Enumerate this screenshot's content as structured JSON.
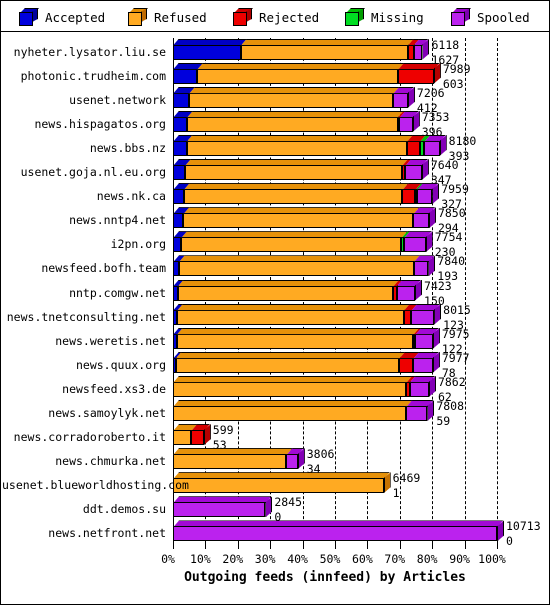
{
  "legend": {
    "items": [
      {
        "label": "Accepted",
        "color": "#0000dd",
        "icon": "cube-icon"
      },
      {
        "label": "Refused",
        "color": "#ffaa22",
        "icon": "cube-icon"
      },
      {
        "label": "Rejected",
        "color": "#ee0000",
        "icon": "cube-icon"
      },
      {
        "label": "Missing",
        "color": "#00dd22",
        "icon": "cube-icon"
      },
      {
        "label": "Spooled",
        "color": "#bb22ee",
        "icon": "cube-icon"
      }
    ]
  },
  "chart_data": {
    "type": "bar",
    "orientation": "horizontal",
    "stacked": true,
    "title": "",
    "xlabel": "Outgoing feeds (innfeed) by Articles",
    "ylabel": "",
    "xlim": [
      0,
      110
    ],
    "xticks": [
      "0%",
      "10%",
      "20%",
      "30%",
      "40%",
      "50%",
      "60%",
      "70%",
      "80%",
      "90%",
      "100%"
    ],
    "xtick_values": [
      0,
      10,
      20,
      30,
      40,
      50,
      60,
      70,
      80,
      90,
      100
    ],
    "grid": true,
    "legend_position": "top",
    "series_names": [
      "Accepted",
      "Refused",
      "Rejected",
      "Missing",
      "Spooled"
    ],
    "series_colors": [
      "#0000dd",
      "#ffaa22",
      "#ee0000",
      "#00dd22",
      "#bb22ee"
    ],
    "categories": [
      "nyheter.lysator.liu.se",
      "photonic.trudheim.com",
      "usenet.network",
      "news.hispagatos.org",
      "news.bbs.nz",
      "usenet.goja.nl.eu.org",
      "news.nk.ca",
      "news.nntp4.net",
      "i2pn.org",
      "newsfeed.bofh.team",
      "nntp.comgw.net",
      "news.tnetconsulting.net",
      "news.weretis.net",
      "news.quux.org",
      "newsfeed.xs3.de",
      "news.samoylyk.net",
      "news.corradoroberto.it",
      "news.chmurka.net",
      "usenet.blueworldhosting.com",
      "ddt.demos.su",
      "news.netfront.net"
    ],
    "rows": [
      {
        "label": "nyheter.lysator.liu.se",
        "value_top": "6118",
        "value_bottom": "1627",
        "total_pct": 77.0,
        "segments": [
          {
            "name": "Accepted",
            "pct": 21.0
          },
          {
            "name": "Refused",
            "pct": 51.5
          },
          {
            "name": "Rejected",
            "pct": 1.8
          },
          {
            "name": "Spooled",
            "pct": 2.7
          }
        ]
      },
      {
        "label": "photonic.trudheim.com",
        "value_top": "7989",
        "value_bottom": "603",
        "total_pct": 80.5,
        "segments": [
          {
            "name": "Accepted",
            "pct": 7.5
          },
          {
            "name": "Refused",
            "pct": 62.0
          },
          {
            "name": "Rejected",
            "pct": 11.0
          }
        ]
      },
      {
        "label": "usenet.network",
        "value_top": "7206",
        "value_bottom": "412",
        "total_pct": 72.5,
        "segments": [
          {
            "name": "Accepted",
            "pct": 5.0
          },
          {
            "name": "Refused",
            "pct": 63.0
          },
          {
            "name": "Spooled",
            "pct": 4.5
          }
        ]
      },
      {
        "label": "news.hispagatos.org",
        "value_top": "7353",
        "value_bottom": "396",
        "total_pct": 74.0,
        "segments": [
          {
            "name": "Accepted",
            "pct": 4.3
          },
          {
            "name": "Refused",
            "pct": 65.0
          },
          {
            "name": "Rejected",
            "pct": 0.6
          },
          {
            "name": "Spooled",
            "pct": 4.1
          }
        ]
      },
      {
        "label": "news.bbs.nz",
        "value_top": "8180",
        "value_bottom": "393",
        "total_pct": 82.3,
        "segments": [
          {
            "name": "Accepted",
            "pct": 4.2
          },
          {
            "name": "Refused",
            "pct": 68.0
          },
          {
            "name": "Rejected",
            "pct": 4.0
          },
          {
            "name": "Missing",
            "pct": 1.4
          },
          {
            "name": "Spooled",
            "pct": 4.7
          }
        ]
      },
      {
        "label": "usenet.goja.nl.eu.org",
        "value_top": "7640",
        "value_bottom": "347",
        "total_pct": 76.8,
        "segments": [
          {
            "name": "Accepted",
            "pct": 3.7
          },
          {
            "name": "Refused",
            "pct": 67.0
          },
          {
            "name": "Rejected",
            "pct": 1.0
          },
          {
            "name": "Spooled",
            "pct": 5.1
          }
        ]
      },
      {
        "label": "news.nk.ca",
        "value_top": "7959",
        "value_bottom": "327",
        "total_pct": 80.0,
        "segments": [
          {
            "name": "Accepted",
            "pct": 3.3
          },
          {
            "name": "Refused",
            "pct": 67.5
          },
          {
            "name": "Rejected",
            "pct": 4.0
          },
          {
            "name": "Missing",
            "pct": 0.5
          },
          {
            "name": "Spooled",
            "pct": 4.7
          }
        ]
      },
      {
        "label": "news.nntp4.net",
        "value_top": "7850",
        "value_bottom": "294",
        "total_pct": 79.0,
        "segments": [
          {
            "name": "Accepted",
            "pct": 3.2
          },
          {
            "name": "Refused",
            "pct": 71.0
          },
          {
            "name": "Spooled",
            "pct": 4.8
          }
        ]
      },
      {
        "label": "i2pn.org",
        "value_top": "7754",
        "value_bottom": "230",
        "total_pct": 78.0,
        "segments": [
          {
            "name": "Accepted",
            "pct": 2.5
          },
          {
            "name": "Refused",
            "pct": 68.0
          },
          {
            "name": "Missing",
            "pct": 0.8
          },
          {
            "name": "Spooled",
            "pct": 6.7
          }
        ]
      },
      {
        "label": "newsfeed.bofh.team",
        "value_top": "7840",
        "value_bottom": "193",
        "total_pct": 78.8,
        "segments": [
          {
            "name": "Accepted",
            "pct": 1.8
          },
          {
            "name": "Refused",
            "pct": 72.5
          },
          {
            "name": "Spooled",
            "pct": 4.5
          }
        ]
      },
      {
        "label": "nntp.comgw.net",
        "value_top": "7423",
        "value_bottom": "150",
        "total_pct": 74.7,
        "segments": [
          {
            "name": "Accepted",
            "pct": 1.5
          },
          {
            "name": "Refused",
            "pct": 66.5
          },
          {
            "name": "Rejected",
            "pct": 1.0
          },
          {
            "name": "Spooled",
            "pct": 5.7
          }
        ]
      },
      {
        "label": "news.tnetconsulting.net",
        "value_top": "8015",
        "value_bottom": "123",
        "total_pct": 80.6,
        "segments": [
          {
            "name": "Accepted",
            "pct": 1.3
          },
          {
            "name": "Refused",
            "pct": 70.0
          },
          {
            "name": "Rejected",
            "pct": 2.3
          },
          {
            "name": "Spooled",
            "pct": 7.0
          }
        ]
      },
      {
        "label": "news.weretis.net",
        "value_top": "7975",
        "value_bottom": "122",
        "total_pct": 80.2,
        "segments": [
          {
            "name": "Accepted",
            "pct": 1.2
          },
          {
            "name": "Refused",
            "pct": 73.0
          },
          {
            "name": "Rejected",
            "pct": 0.6
          },
          {
            "name": "Spooled",
            "pct": 5.4
          }
        ]
      },
      {
        "label": "news.quux.org",
        "value_top": "7977",
        "value_bottom": "78",
        "total_pct": 80.2,
        "segments": [
          {
            "name": "Accepted",
            "pct": 0.8
          },
          {
            "name": "Refused",
            "pct": 69.0
          },
          {
            "name": "Rejected",
            "pct": 4.4
          },
          {
            "name": "Spooled",
            "pct": 6.0
          }
        ]
      },
      {
        "label": "newsfeed.xs3.de",
        "value_top": "7862",
        "value_bottom": "62",
        "total_pct": 79.0,
        "segments": [
          {
            "name": "Refused",
            "pct": 72.0
          },
          {
            "name": "Rejected",
            "pct": 1.0
          },
          {
            "name": "Spooled",
            "pct": 6.0
          }
        ]
      },
      {
        "label": "news.samoylyk.net",
        "value_top": "7808",
        "value_bottom": "59",
        "total_pct": 78.5,
        "segments": [
          {
            "name": "Refused",
            "pct": 72.0
          },
          {
            "name": "Spooled",
            "pct": 6.5
          }
        ]
      },
      {
        "label": "news.corradoroberto.it",
        "value_top": "599",
        "value_bottom": "53",
        "total_pct": 9.5,
        "segments": [
          {
            "name": "Refused",
            "pct": 5.6
          },
          {
            "name": "Rejected",
            "pct": 3.9
          }
        ]
      },
      {
        "label": "news.chmurka.net",
        "value_top": "3806",
        "value_bottom": "34",
        "total_pct": 38.5,
        "segments": [
          {
            "name": "Refused",
            "pct": 35.0
          },
          {
            "name": "Spooled",
            "pct": 3.5
          }
        ]
      },
      {
        "label": "usenet.blueworldhosting.com",
        "value_top": "6469",
        "value_bottom": "1",
        "total_pct": 65.0,
        "segments": [
          {
            "name": "Refused",
            "pct": 65.0
          }
        ]
      },
      {
        "label": "ddt.demos.su",
        "value_top": "2845",
        "value_bottom": "0",
        "total_pct": 28.5,
        "segments": [
          {
            "name": "Spooled",
            "pct": 28.5
          }
        ]
      },
      {
        "label": "news.netfront.net",
        "value_top": "10713",
        "value_bottom": "0",
        "total_pct": 100.0,
        "segments": [
          {
            "name": "Spooled",
            "pct": 100.0
          }
        ]
      }
    ]
  }
}
